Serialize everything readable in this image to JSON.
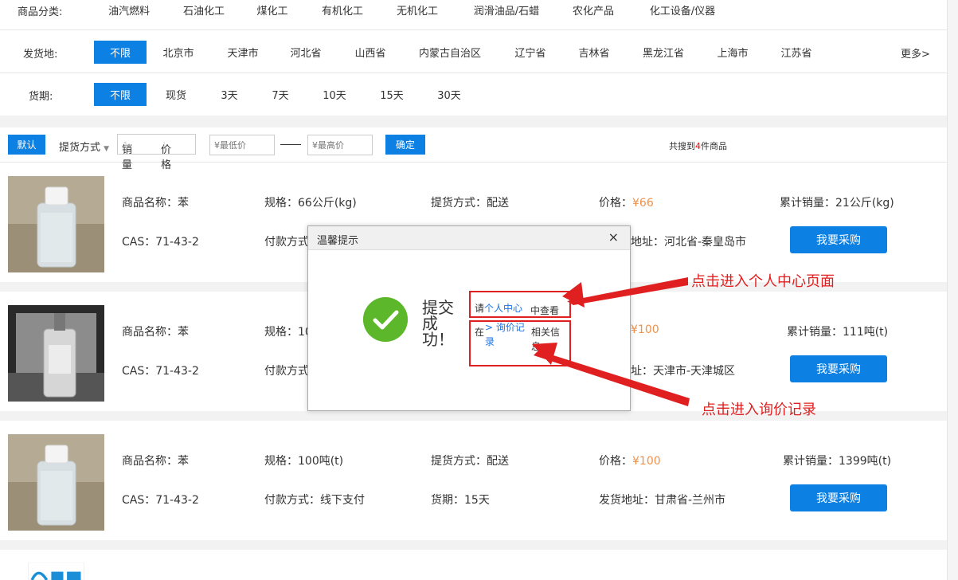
{
  "filters": {
    "category": {
      "label": "商品分类:",
      "options": [
        "油汽燃料",
        "石油化工",
        "煤化工",
        "有机化工",
        "无机化工",
        "润滑油品/石蜡",
        "农化产品",
        "化工设备/仪器"
      ]
    },
    "origin": {
      "label": "发货地:",
      "options": [
        "不限",
        "北京市",
        "天津市",
        "河北省",
        "山西省",
        "内蒙古自治区",
        "辽宁省",
        "吉林省",
        "黑龙江省",
        "上海市",
        "江苏省"
      ],
      "selected": "不限",
      "more": "更多>"
    },
    "delivery": {
      "label": "货期:",
      "options": [
        "不限",
        "现货",
        "3天",
        "7天",
        "10天",
        "15天",
        "30天"
      ],
      "selected": "不限"
    }
  },
  "sort_bar": {
    "default": "默认",
    "pickup": "提货方式",
    "sales": "销量",
    "price": "价格",
    "min_placeholder": "¥最低价",
    "max_placeholder": "¥最高价",
    "confirm": "确定",
    "result_prefix": "共搜到",
    "result_count": "4",
    "result_suffix": "件商品"
  },
  "products": [
    {
      "name": "商品名称：苯",
      "cas": "CAS：71-43-2",
      "spec": "规格：66公斤(kg)",
      "payment": "付款方式",
      "pickup": "提货方式：配送",
      "price_label": "价格：",
      "price": "¥66",
      "address": "地址：河北省-秦皇岛市",
      "sales": "累计销量：21公斤(kg)",
      "buy": "我要采购"
    },
    {
      "name": "商品名称：苯",
      "cas": "CAS：71-43-2",
      "spec": "规格：10",
      "payment": "付款方式",
      "price": "¥100",
      "address": "址：天津市-天津城区",
      "sales": "累计销量：111吨(t)",
      "buy": "我要采购"
    },
    {
      "name": "商品名称：苯",
      "cas": "CAS：71-43-2",
      "spec": "规格：100吨(t)",
      "payment": "付款方式：线下支付",
      "pickup": "提货方式：配送",
      "delivery": "货期：15天",
      "price_label": "价格：",
      "price": "¥100",
      "address": "发货地址：甘肃省-兰州市",
      "sales": "累计销量：1399吨(t)",
      "buy": "我要采购"
    }
  ],
  "dialog": {
    "title": "温馨提示",
    "close": "×",
    "success": "提交成功！",
    "line1_pre": "请",
    "line1_link": "个人中心",
    "line1_post": "中查看",
    "line2_pre": "在",
    "line2_link": "> 询价记录",
    "line2_post": "相关信息"
  },
  "annotations": {
    "personal_center": "点击进入个人中心页面",
    "inquiry_records": "点击进入询价记录"
  },
  "colors": {
    "accent": "#0c80e3",
    "price": "#f19149",
    "success": "#5cb82a",
    "annotation": "#e02020"
  }
}
